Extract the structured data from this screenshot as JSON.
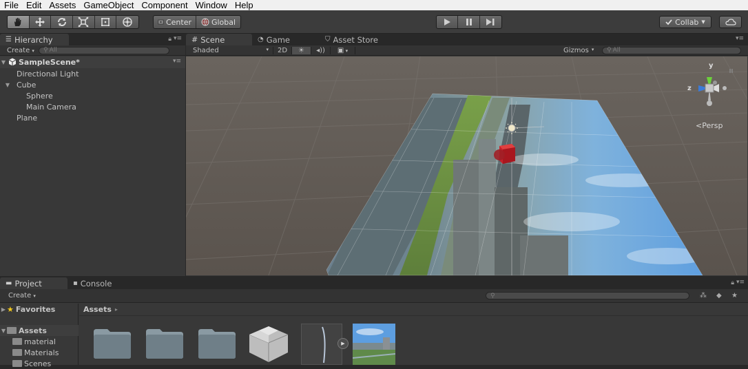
{
  "menu": [
    "File",
    "Edit",
    "Assets",
    "GameObject",
    "Component",
    "Window",
    "Help"
  ],
  "toolbar": {
    "tools": [
      "hand-icon",
      "move-icon",
      "rotate-icon",
      "scale-icon",
      "rect-icon",
      "transform-icon"
    ],
    "pivot_label": "Center",
    "space_label": "Global",
    "collab_label": "Collab",
    "play_icons": [
      "play-icon",
      "pause-icon",
      "step-icon"
    ]
  },
  "hierarchy": {
    "tab": "Hierarchy",
    "create": "Create",
    "search_placeholder": "All",
    "scene_name": "SampleScene*",
    "items": [
      {
        "label": "Directional Light",
        "depth": 1,
        "expander": false
      },
      {
        "label": "Cube",
        "depth": 1,
        "expander": true
      },
      {
        "label": "Sphere",
        "depth": 2,
        "expander": false
      },
      {
        "label": "Main Camera",
        "depth": 2,
        "expander": false
      },
      {
        "label": "Plane",
        "depth": 1,
        "expander": false
      }
    ]
  },
  "scene": {
    "tabs": [
      "Scene",
      "Game",
      "Asset Store"
    ],
    "shading": "Shaded",
    "mode_2d": "2D",
    "gizmos": "Gizmos",
    "search_placeholder": "All",
    "persp_label": "Persp",
    "axis_y": "y",
    "axis_z": "z"
  },
  "project": {
    "tabs": [
      "Project",
      "Console"
    ],
    "create": "Create",
    "favorites": "Favorites",
    "assets_root": "Assets",
    "breadcrumb": "Assets",
    "folders": [
      "material",
      "Materials",
      "Scenes"
    ]
  },
  "colors": {
    "accent": "#3d6399",
    "cube": "#c4222b"
  }
}
